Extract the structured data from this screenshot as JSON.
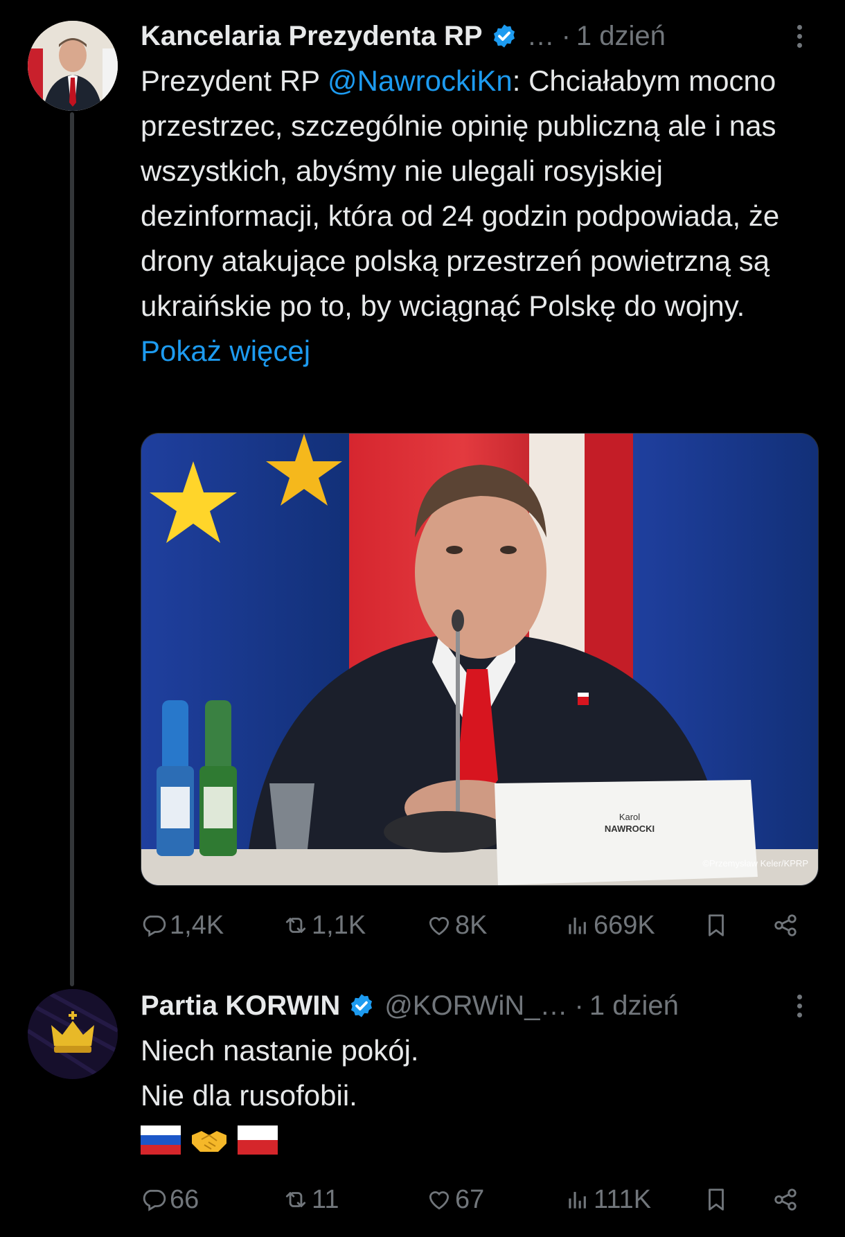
{
  "tweets": [
    {
      "author_name": "Kancelaria Prezydenta RP",
      "handle": "…",
      "dot": "·",
      "time": "1 dzień",
      "text_before": "Prezydent RP ",
      "mention": "@NawrockiKn",
      "text_after": ": Chciałabym mocno przestrzec, szczególnie opinię publiczną ale i nas wszystkich, abyśmy nie ulegali rosyjskiej dezinformacji, która od 24 godzin podpowiada, że drony atakujące polską przestrzeń powietrzną są ukraińskie po to, by wciągnąć Polskę do wojny. ",
      "show_more": "Pokaż więcej",
      "media": {
        "nameplate_first": "Karol",
        "nameplate_last": "NAWROCKI",
        "credit": "©Przemysław Keler/KPRP"
      },
      "stats": {
        "replies": "1,4K",
        "reposts": "1,1K",
        "likes": "8K",
        "views": "669K"
      }
    },
    {
      "author_name": "Partia KORWIN",
      "handle": "@KORWiN_…",
      "dot": "·",
      "time": "1 dzień",
      "line1": "Niech nastanie pokój.",
      "line2": "Nie dla rusofobii.",
      "stats": {
        "replies": "66",
        "reposts": "11",
        "likes": "67",
        "views": "111K"
      }
    }
  ],
  "icons": [
    "reply-icon",
    "repost-icon",
    "like-icon",
    "views-icon",
    "bookmark-icon",
    "share-icon",
    "verified-icon",
    "more-icon"
  ],
  "colors": {
    "accent": "#1d9bf0",
    "muted": "#71767b",
    "text": "#e7e9ea",
    "background": "#000000"
  }
}
